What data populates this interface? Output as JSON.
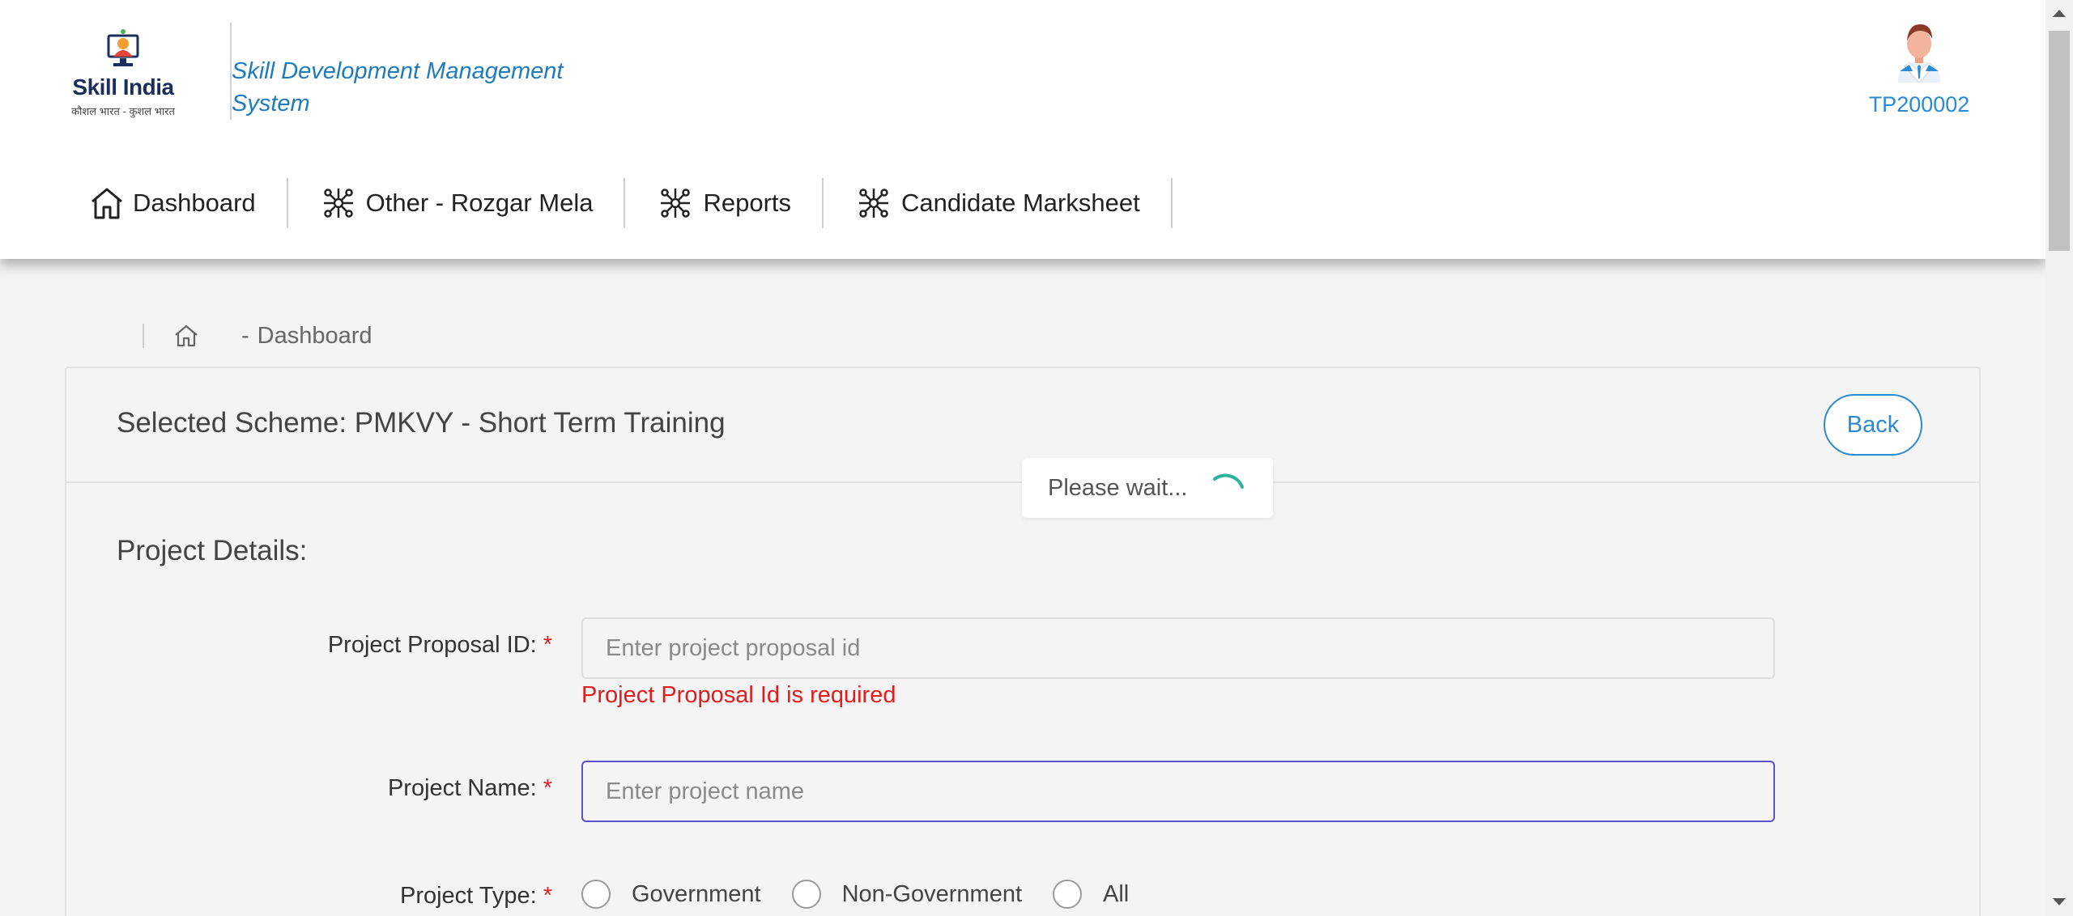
{
  "header": {
    "logo": {
      "word": "Skill India",
      "tagline": "कौशल भारत - कुशल भारत"
    },
    "system_title": "Skill Development Management System",
    "user_id": "TP200002"
  },
  "nav": [
    {
      "label": "Dashboard",
      "icon": "home-icon"
    },
    {
      "label": "Other - Rozgar Mela",
      "icon": "network-icon"
    },
    {
      "label": "Reports",
      "icon": "network-icon"
    },
    {
      "label": "Candidate Marksheet",
      "icon": "network-icon"
    }
  ],
  "breadcrumb": {
    "separator": "-",
    "current": "Dashboard"
  },
  "card": {
    "scheme": "Selected Scheme: PMKVY - Short Term Training",
    "back_label": "Back",
    "section_title": "Project Details:",
    "fields": {
      "proposal": {
        "label": "Project Proposal ID:",
        "required": "*",
        "placeholder": "Enter project proposal id",
        "error": "Project Proposal Id is required"
      },
      "name": {
        "label": "Project Name:",
        "required": "*",
        "placeholder": "Enter project name"
      },
      "type": {
        "label": "Project Type:",
        "required": "*",
        "options": [
          "Government",
          "Non-Government",
          "All"
        ]
      }
    }
  },
  "overlay": {
    "text": "Please wait..."
  },
  "colors": {
    "accent": "#2b8ad1",
    "error": "#e01c1c",
    "focus": "#5b50c7",
    "spinner": "#2bb39a"
  }
}
